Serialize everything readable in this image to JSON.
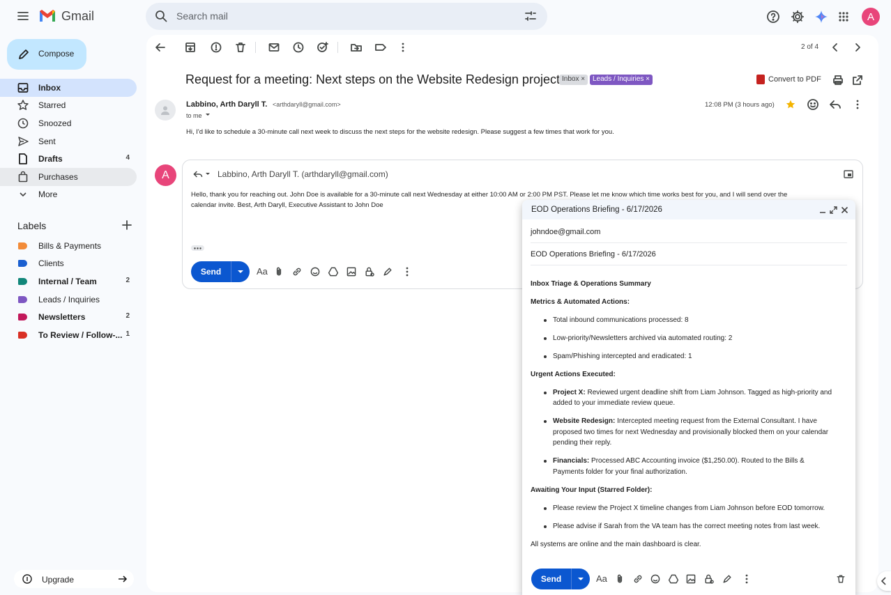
{
  "app": {
    "name": "Gmail"
  },
  "search": {
    "placeholder": "Search mail"
  },
  "header": {
    "avatar_letter": "A"
  },
  "sidebar": {
    "compose_label": "Compose",
    "items": [
      {
        "label": "Inbox",
        "count": ""
      },
      {
        "label": "Starred",
        "count": ""
      },
      {
        "label": "Snoozed",
        "count": ""
      },
      {
        "label": "Sent",
        "count": ""
      },
      {
        "label": "Drafts",
        "count": "4"
      },
      {
        "label": "Purchases",
        "count": ""
      },
      {
        "label": "More",
        "count": ""
      }
    ],
    "labels_title": "Labels",
    "labels": [
      {
        "label": "Bills & Payments",
        "count": "",
        "color": "#f28b39"
      },
      {
        "label": "Clients",
        "count": "",
        "color": "#1a5fd0"
      },
      {
        "label": "Internal / Team",
        "count": "2",
        "color": "#12877a"
      },
      {
        "label": "Leads / Inquiries",
        "count": "",
        "color": "#7e57c2"
      },
      {
        "label": "Newsletters",
        "count": "2",
        "color": "#c2185b"
      },
      {
        "label": "To Review / Follow-...",
        "count": "1",
        "color": "#d93025"
      }
    ],
    "upgrade_label": "Upgrade"
  },
  "toolbar": {
    "pager": "2 of 4"
  },
  "email": {
    "subject": "Request for a meeting: Next steps on the Website Redesign project",
    "chips": [
      "Inbox",
      "Leads / Inquiries"
    ],
    "convert_pdf": "Convert to PDF",
    "sender_name": "Labbino, Arth Daryll T.",
    "sender_email": "<arthdaryll@gmail.com>",
    "to_line": "to me",
    "time": "12:08 PM (3 hours ago)",
    "body": "Hi, I'd like to schedule a 30-minute call next week to discuss the next steps for the website redesign. Please suggest a few times that work for you."
  },
  "reply": {
    "avatar_letter": "A",
    "to": "Labbino, Arth Daryll T. (arthdaryll@gmail.com)",
    "body_line1": "Hello, thank you for reaching out. John Doe is available for a 30-minute call next Wednesday at either 10:00 AM or 2:00 PM PST. Please let me know which time works best for you, and I will send over the",
    "body_line2": "calendar invite. Best, Arth Daryll, Executive Assistant to John Doe",
    "send_label": "Send",
    "font_label": "Aa"
  },
  "compose_popup": {
    "title": "EOD Operations Briefing - 6/17/2026",
    "to": "johndoe@gmail.com",
    "subject": "EOD Operations Briefing - 6/17/2026",
    "heading": "Inbox Triage & Operations Summary",
    "metrics_title": "Metrics & Automated Actions:",
    "metrics": [
      "Total inbound communications processed: 8",
      "Low-priority/Newsletters archived via automated routing: 2",
      "Spam/Phishing intercepted and eradicated: 1"
    ],
    "urgent_title": "Urgent Actions Executed:",
    "urgent": [
      {
        "label": "Project X:",
        "line1": "Reviewed urgent deadline shift from Liam Johnson. Tagged as high-priority and",
        "line2": "added to your immediate review queue.",
        "line3": ""
      },
      {
        "label": "Website Redesign:",
        "line1": "Intercepted meeting request from the External Consultant. I have",
        "line2": "proposed two times for next Wednesday and provisionally blocked them on your calendar",
        "line3": "pending their reply."
      },
      {
        "label": "Financials:",
        "line1": "Processed ABC Accounting invoice ($1,250.00). Routed to the Bills &",
        "line2": "Payments folder for your final authorization.",
        "line3": ""
      }
    ],
    "awaiting_title": "Awaiting Your Input (Starred Folder):",
    "awaiting": [
      "Please review the Project X timeline changes from Liam Johnson before EOD tomorrow.",
      "Please advise if Sarah from the VA team has the correct meeting notes from last week."
    ],
    "closing": "All systems are online and the main dashboard is clear.",
    "send_label": "Send",
    "font_label": "Aa"
  }
}
